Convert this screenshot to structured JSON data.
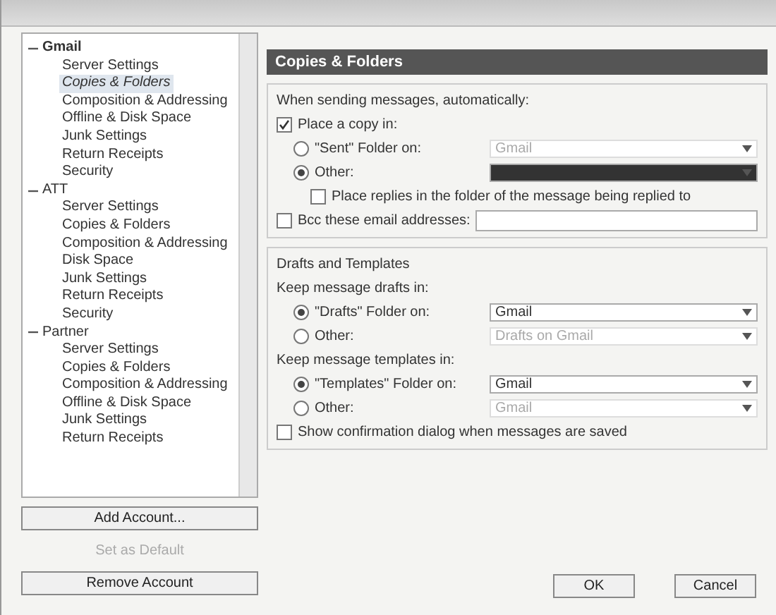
{
  "accounts": [
    {
      "name": "Gmail",
      "expanded": true,
      "children": [
        {
          "label": "Server Settings",
          "selected": false
        },
        {
          "label": "Copies & Folders",
          "selected": true
        },
        {
          "label": "Composition & Addressing",
          "selected": false
        },
        {
          "label": "Offline & Disk Space",
          "selected": false
        },
        {
          "label": "Junk Settings",
          "selected": false
        },
        {
          "label": "Return Receipts",
          "selected": false
        },
        {
          "label": "Security",
          "selected": false
        }
      ]
    },
    {
      "name": "ATT",
      "expanded": true,
      "children": [
        {
          "label": "Server Settings",
          "selected": false
        },
        {
          "label": "Copies & Folders",
          "selected": false
        },
        {
          "label": "Composition & Addressing",
          "selected": false
        },
        {
          "label": "Disk Space",
          "selected": false
        },
        {
          "label": "Junk Settings",
          "selected": false
        },
        {
          "label": "Return Receipts",
          "selected": false
        },
        {
          "label": "Security",
          "selected": false
        }
      ]
    },
    {
      "name": "Partner",
      "expanded": true,
      "children": [
        {
          "label": "Server Settings",
          "selected": false
        },
        {
          "label": "Copies & Folders",
          "selected": false
        },
        {
          "label": "Composition & Addressing",
          "selected": false
        },
        {
          "label": "Offline & Disk Space",
          "selected": false
        },
        {
          "label": "Junk Settings",
          "selected": false
        },
        {
          "label": "Return Receipts",
          "selected": false
        }
      ]
    }
  ],
  "account_buttons": [
    {
      "label": "Add Account...",
      "disabled": false
    },
    {
      "label": "Set as Default",
      "disabled": true
    },
    {
      "label": "Remove Account",
      "disabled": false
    }
  ],
  "page_title": "Copies & Folders",
  "sending": {
    "intro": "When sending messages, automatically:",
    "place_copy": {
      "label": "Place a copy in:",
      "checked": true
    },
    "options": [
      {
        "label": "\"Sent\" Folder on:",
        "selected": false,
        "value": "Gmail",
        "disabled": true,
        "highlighted": false
      },
      {
        "label": "Other:",
        "selected": true,
        "disabled": false,
        "highlighted": true
      }
    ],
    "place_replies": {
      "label": "Place replies in the folder of the message being replied to",
      "checked": false
    },
    "bcc": {
      "label": "Bcc these email addresses:",
      "checked": false
    }
  },
  "drafts": {
    "heading": "Drafts and Templates",
    "groups": [
      {
        "label": "Keep message drafts in:",
        "options": [
          {
            "label": "\"Drafts\" Folder on:",
            "selected": true,
            "value": "Gmail",
            "disabled": false
          },
          {
            "label": "Other:",
            "selected": false,
            "value": "Drafts on Gmail",
            "disabled": true
          }
        ]
      },
      {
        "label": "Keep message templates in:",
        "options": [
          {
            "label": "\"Templates\" Folder on:",
            "selected": true,
            "value": "Gmail",
            "disabled": false
          },
          {
            "label": "Other:",
            "selected": false,
            "value": "Gmail",
            "disabled": true
          }
        ]
      }
    ],
    "confirm": {
      "label": "Show confirmation dialog when messages are saved",
      "checked": false
    }
  },
  "buttons": [
    "OK",
    "Cancel"
  ]
}
